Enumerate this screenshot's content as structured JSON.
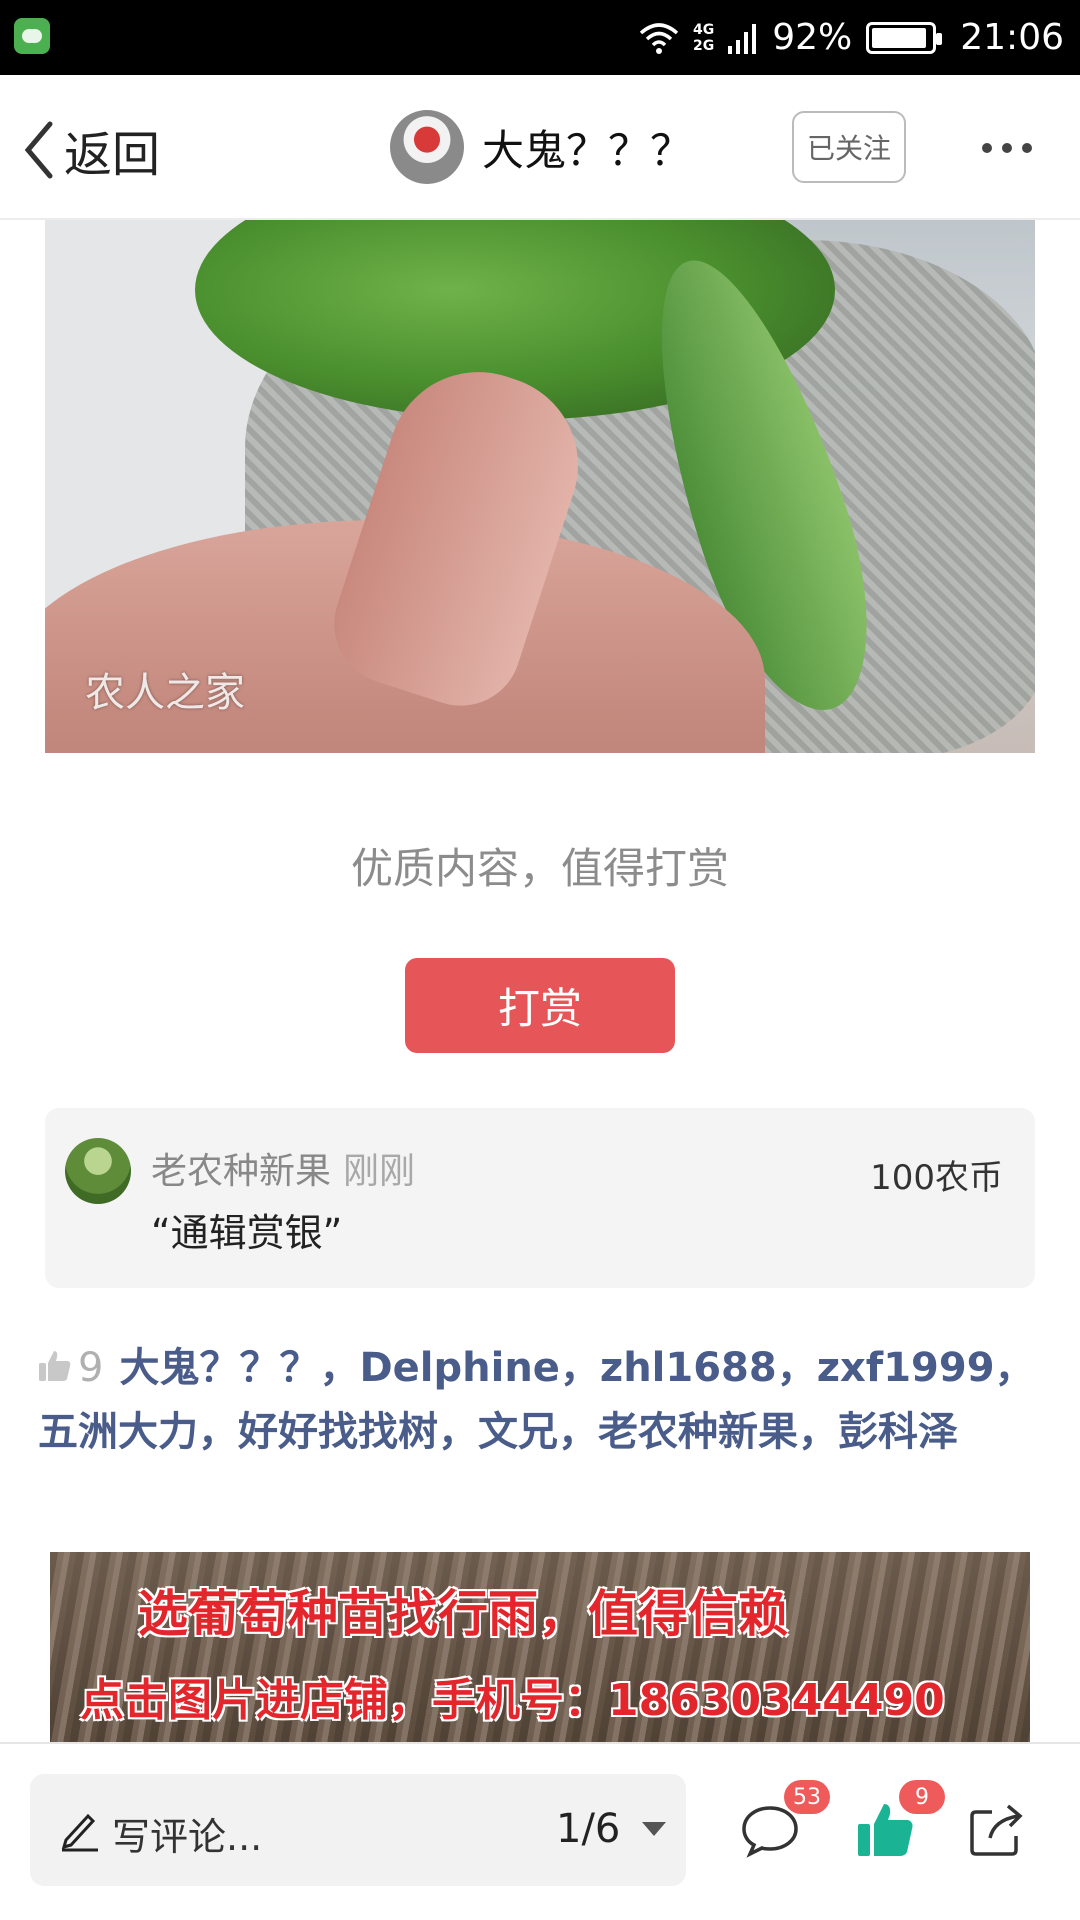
{
  "status_bar": {
    "network_top": "4G",
    "network_bottom": "2G",
    "battery": "92%",
    "battery_level": 0.92,
    "time": "21:06"
  },
  "header": {
    "back_label": "返回",
    "author_name": "大鬼？？？",
    "follow_label": "已关注"
  },
  "content": {
    "photo_watermark": "农人之家",
    "reward_prompt": "优质内容，值得打赏",
    "reward_button": "打赏"
  },
  "reward_record": {
    "name": "老农种新果",
    "time": "刚刚",
    "amount": "100农币",
    "message": "“通辑赏银”"
  },
  "likes": {
    "count": "9",
    "names": "大鬼？？？，Delphine，zhl1688，zxf1999，五洲大力，好好找找树，文兄，老农种新果，彭科泽"
  },
  "banner": {
    "line1": "选葡萄种苗找行雨，值得信赖",
    "line2": "点击图片进店铺，手机号：18630344490"
  },
  "bottom_bar": {
    "comment_placeholder": "写评论...",
    "page_indicator": "1/6",
    "comment_count": "53",
    "like_count": "9",
    "accent_color": "#1ab394",
    "badge_color": "#ef5a5a"
  }
}
